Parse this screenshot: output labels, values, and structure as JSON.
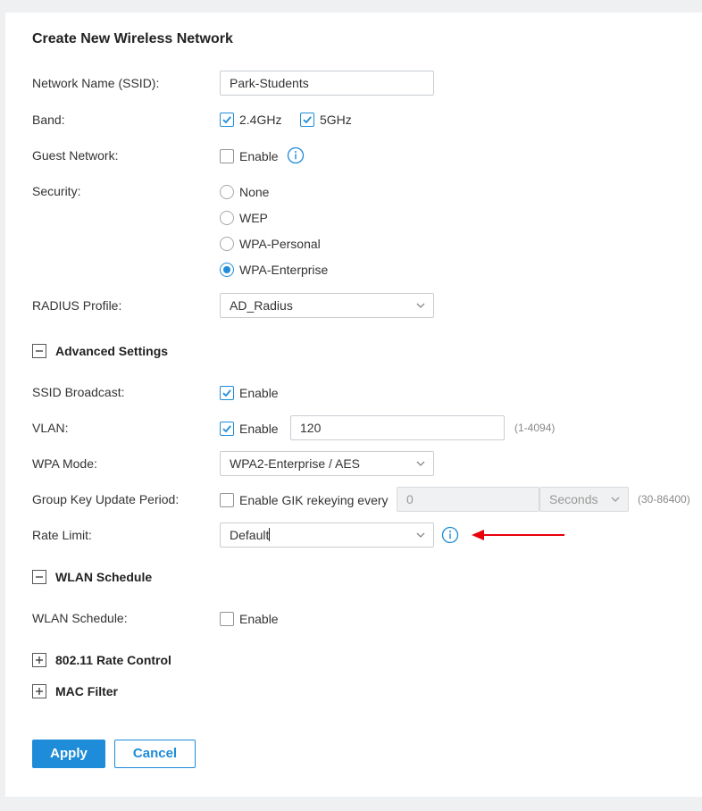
{
  "form": {
    "title": "Create New Wireless Network",
    "ssid": {
      "label": "Network Name (SSID):",
      "value": "Park-Students"
    },
    "band": {
      "label": "Band:",
      "option_24": "2.4GHz",
      "option_5": "5GHz",
      "checked_24": true,
      "checked_5": true
    },
    "guest": {
      "label": "Guest Network:",
      "enable": "Enable",
      "checked": false,
      "info_icon": "info-icon"
    },
    "security": {
      "label": "Security:",
      "options": [
        "None",
        "WEP",
        "WPA-Personal",
        "WPA-Enterprise"
      ],
      "selected": "WPA-Enterprise"
    },
    "radius": {
      "label": "RADIUS Profile:",
      "value": "AD_Radius"
    }
  },
  "advanced": {
    "title": "Advanced Settings",
    "toggle_icon": "minus-icon",
    "ssid_broadcast": {
      "label": "SSID Broadcast:",
      "enable": "Enable",
      "checked": true
    },
    "vlan": {
      "label": "VLAN:",
      "enable": "Enable",
      "checked": true,
      "value": "120",
      "range": "(1-4094)"
    },
    "wpa_mode": {
      "label": "WPA Mode:",
      "value": "WPA2-Enterprise / AES"
    },
    "gik": {
      "label": "Group Key Update Period:",
      "enable": "Enable GIK rekeying every",
      "checked": false,
      "value": "0",
      "unit": "Seconds",
      "range": "(30-86400)"
    },
    "rate_limit": {
      "label": "Rate Limit:",
      "value": "Default",
      "info_icon": "info-icon"
    }
  },
  "wlan_schedule": {
    "title": "WLAN Schedule",
    "toggle_icon": "minus-icon",
    "label": "WLAN Schedule:",
    "enable": "Enable",
    "checked": false
  },
  "rate_control": {
    "title": "802.11 Rate Control",
    "toggle_icon": "plus-icon"
  },
  "mac_filter": {
    "title": "MAC Filter",
    "toggle_icon": "plus-icon"
  },
  "buttons": {
    "apply": "Apply",
    "cancel": "Cancel"
  },
  "annotation": {
    "arrow_icon": "arrow-left-icon",
    "color": "#e8000b"
  },
  "colors": {
    "accent": "#1e8cd8",
    "background": "#eef0f2"
  }
}
